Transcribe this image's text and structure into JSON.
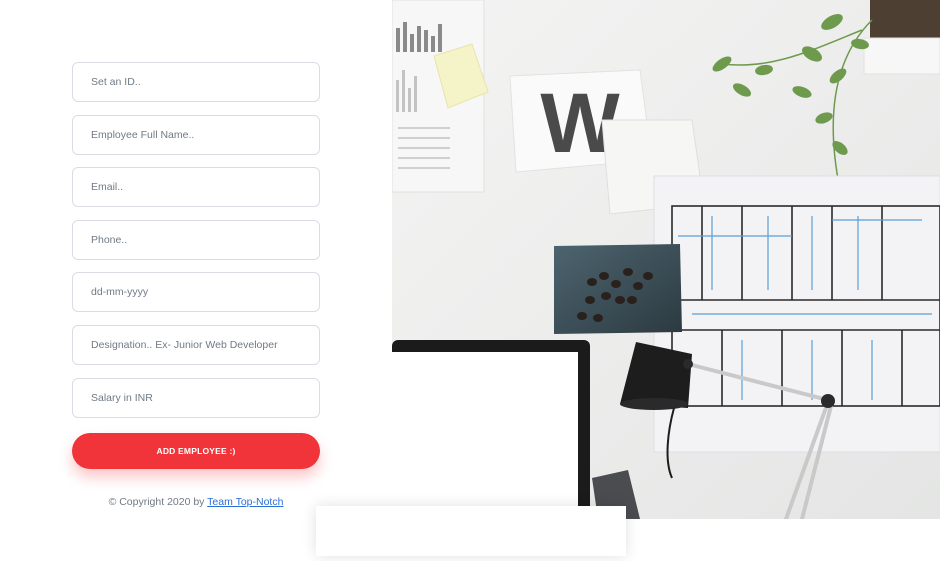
{
  "form": {
    "id_placeholder": "Set an ID..",
    "name_placeholder": "Employee Full Name..",
    "email_placeholder": "Email..",
    "phone_placeholder": "Phone..",
    "date_placeholder": "dd-mm-yyyy",
    "designation_placeholder": "Designation.. Ex- Junior Web Developer",
    "salary_placeholder": "Salary in INR",
    "submit_label": "ADD EMPLOYEE :)"
  },
  "footer": {
    "copyright_prefix": "© Copyright 2020 by",
    "team_link": "Team Top-Notch"
  },
  "hero": {
    "letter": "W"
  },
  "colors": {
    "accent": "#f0343a",
    "link": "#2b6fd6",
    "border": "#d9dde3"
  }
}
